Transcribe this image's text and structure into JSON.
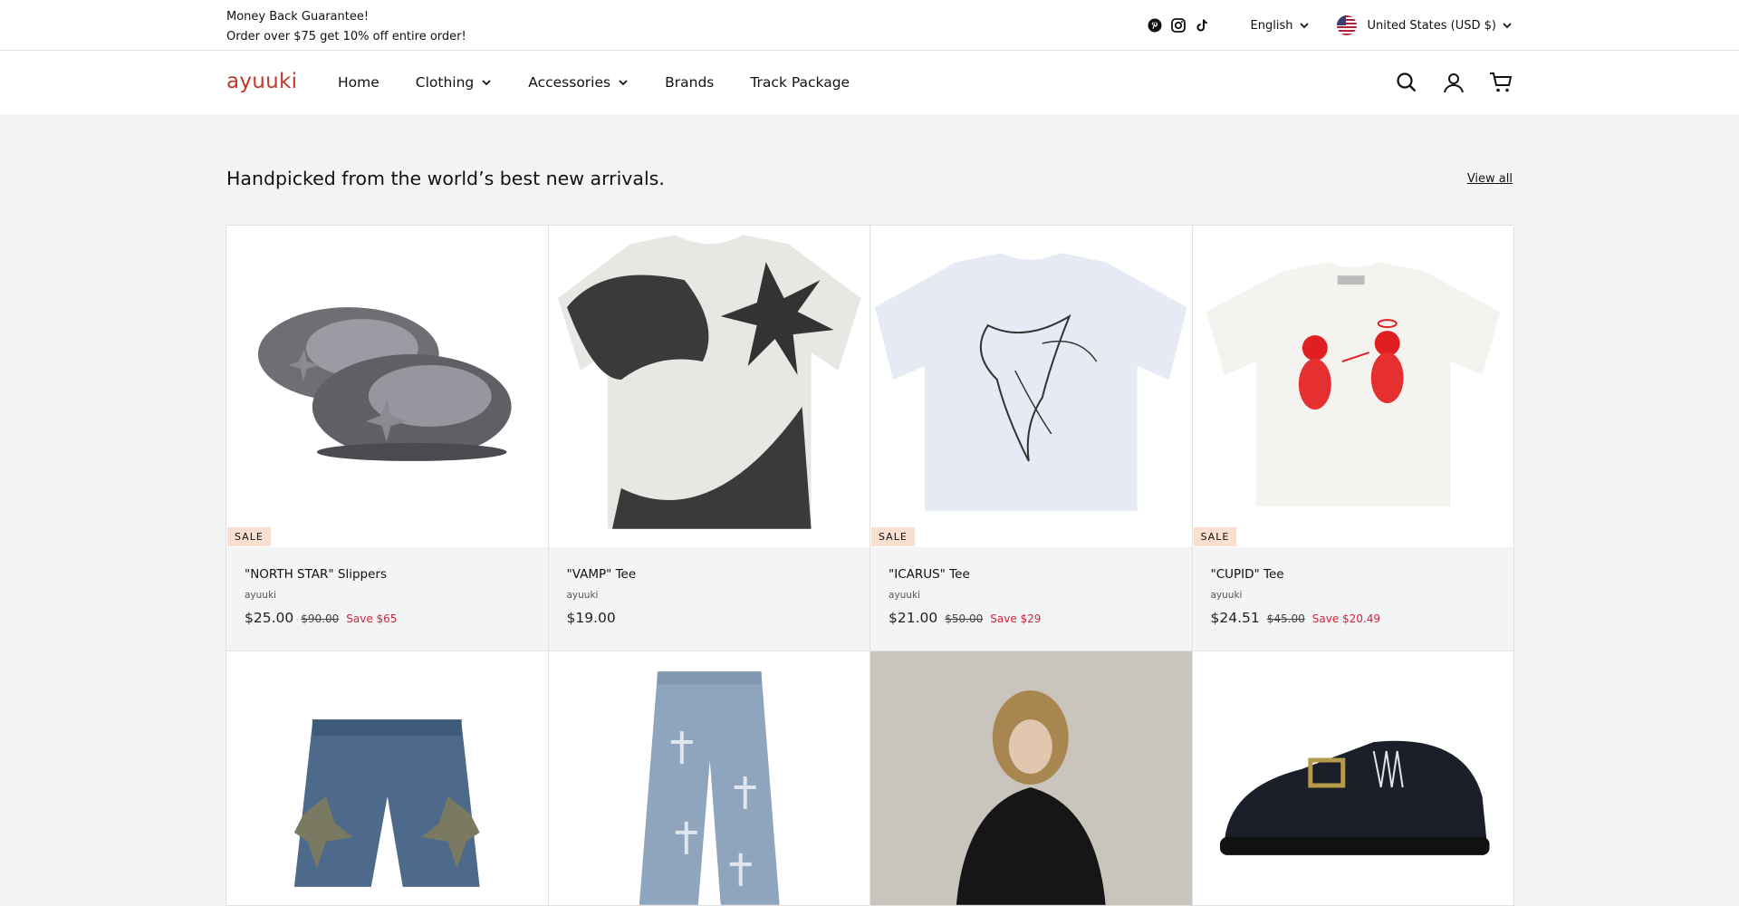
{
  "announcement": {
    "line1": "Money Back Guarantee!",
    "line2": "Order over $75 get 10% off entire order!"
  },
  "top_right": {
    "social_icons": [
      "pinterest-icon",
      "instagram-icon",
      "tiktok-icon"
    ],
    "language": "English",
    "currency": "United States (USD $)"
  },
  "header": {
    "logo": "ayuuki",
    "nav": [
      {
        "label": "Home",
        "dropdown": false
      },
      {
        "label": "Clothing",
        "dropdown": true
      },
      {
        "label": "Accessories",
        "dropdown": true
      },
      {
        "label": "Brands",
        "dropdown": false
      },
      {
        "label": "Track Package",
        "dropdown": false
      }
    ],
    "icons": [
      "search-icon",
      "account-icon",
      "cart-icon"
    ]
  },
  "section": {
    "title": "Handpicked from the world’s best new arrivals.",
    "view_all": "View all"
  },
  "products": [
    {
      "name": "\"NORTH STAR\" Slippers",
      "vendor": "ayuuki",
      "price": "$25.00",
      "compare": "$90.00",
      "save": "Save $65",
      "sale": "SALE"
    },
    {
      "name": "\"VAMP\" Tee",
      "vendor": "ayuuki",
      "price": "$19.00",
      "compare": "",
      "save": "",
      "sale": ""
    },
    {
      "name": "\"ICARUS\" Tee",
      "vendor": "ayuuki",
      "price": "$21.00",
      "compare": "$50.00",
      "save": "Save $29",
      "sale": "SALE"
    },
    {
      "name": "\"CUPID\" Tee",
      "vendor": "ayuuki",
      "price": "$24.51",
      "compare": "$45.00",
      "save": "Save $20.49",
      "sale": "SALE"
    }
  ],
  "colors": {
    "brand": "#c0392b",
    "save_red": "#d0263a",
    "sale_badge_bg": "#f8dfd0",
    "page_bg": "#f3f4f5"
  }
}
